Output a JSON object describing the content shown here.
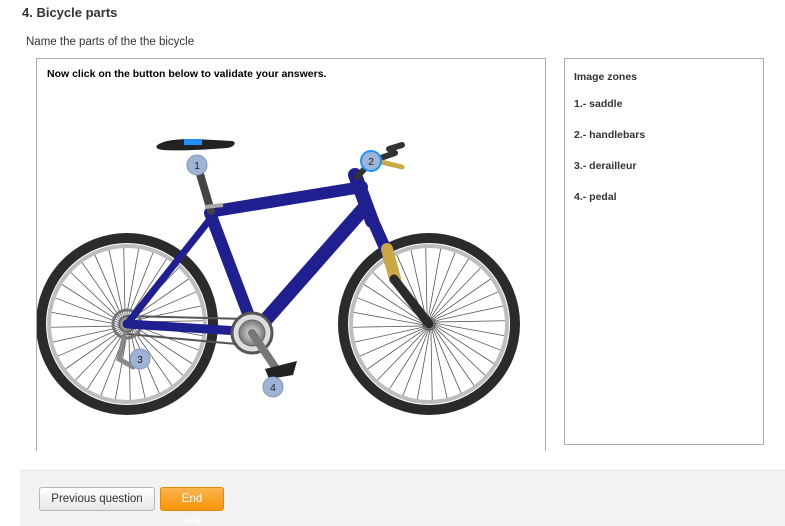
{
  "question": {
    "title": "4. Bicycle parts",
    "statement": "Name the parts of the the bicycle"
  },
  "hotspot": {
    "instruction": "Now click on the button below to validate your answers.",
    "markers": [
      {
        "label": "1",
        "zone": "saddle"
      },
      {
        "label": "2",
        "zone": "handlebars"
      },
      {
        "label": "3",
        "zone": "derailleur"
      },
      {
        "label": "4",
        "zone": "pedal"
      }
    ]
  },
  "zones": {
    "title": "Image zones",
    "items": [
      {
        "label": "1.- saddle"
      },
      {
        "label": "2.- handlebars"
      },
      {
        "label": "3.- derailleur"
      },
      {
        "label": "4.- pedal"
      }
    ]
  },
  "footer": {
    "previous_label": "Previous question",
    "end_label": "End test"
  },
  "colors": {
    "frame": "#1f1f8f",
    "tire": "#2b2b2b",
    "rim": "#b0b0b0",
    "fork": "#c9a845",
    "marker": "#9fb3d6",
    "marker_active": "#1e90ff",
    "end_button": "#f89406"
  }
}
